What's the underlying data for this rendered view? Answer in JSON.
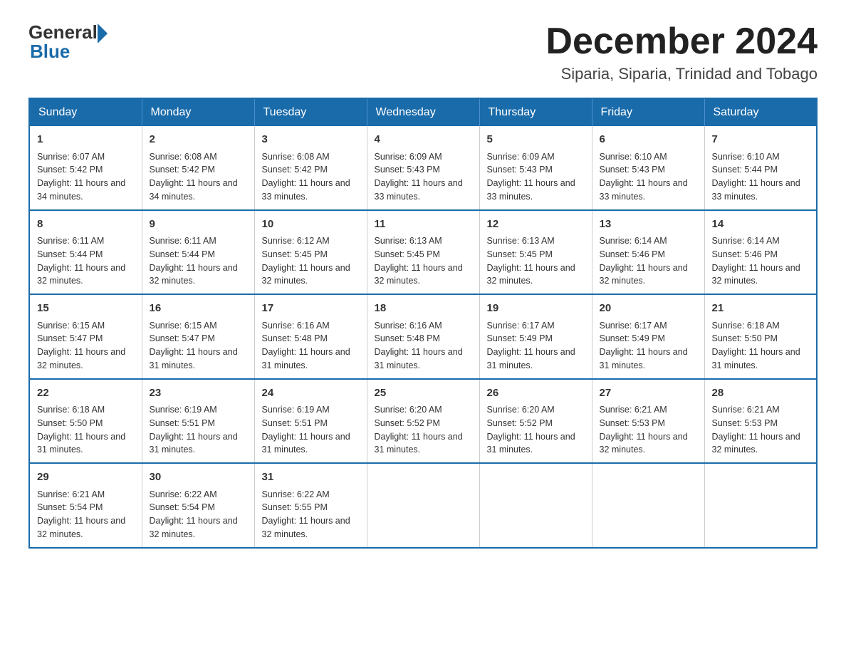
{
  "header": {
    "logo_general": "General",
    "logo_blue": "Blue",
    "title": "December 2024",
    "subtitle": "Siparia, Siparia, Trinidad and Tobago"
  },
  "calendar": {
    "headers": [
      "Sunday",
      "Monday",
      "Tuesday",
      "Wednesday",
      "Thursday",
      "Friday",
      "Saturday"
    ],
    "weeks": [
      [
        {
          "day": "1",
          "sunrise": "6:07 AM",
          "sunset": "5:42 PM",
          "daylight": "11 hours and 34 minutes."
        },
        {
          "day": "2",
          "sunrise": "6:08 AM",
          "sunset": "5:42 PM",
          "daylight": "11 hours and 34 minutes."
        },
        {
          "day": "3",
          "sunrise": "6:08 AM",
          "sunset": "5:42 PM",
          "daylight": "11 hours and 33 minutes."
        },
        {
          "day": "4",
          "sunrise": "6:09 AM",
          "sunset": "5:43 PM",
          "daylight": "11 hours and 33 minutes."
        },
        {
          "day": "5",
          "sunrise": "6:09 AM",
          "sunset": "5:43 PM",
          "daylight": "11 hours and 33 minutes."
        },
        {
          "day": "6",
          "sunrise": "6:10 AM",
          "sunset": "5:43 PM",
          "daylight": "11 hours and 33 minutes."
        },
        {
          "day": "7",
          "sunrise": "6:10 AM",
          "sunset": "5:44 PM",
          "daylight": "11 hours and 33 minutes."
        }
      ],
      [
        {
          "day": "8",
          "sunrise": "6:11 AM",
          "sunset": "5:44 PM",
          "daylight": "11 hours and 32 minutes."
        },
        {
          "day": "9",
          "sunrise": "6:11 AM",
          "sunset": "5:44 PM",
          "daylight": "11 hours and 32 minutes."
        },
        {
          "day": "10",
          "sunrise": "6:12 AM",
          "sunset": "5:45 PM",
          "daylight": "11 hours and 32 minutes."
        },
        {
          "day": "11",
          "sunrise": "6:13 AM",
          "sunset": "5:45 PM",
          "daylight": "11 hours and 32 minutes."
        },
        {
          "day": "12",
          "sunrise": "6:13 AM",
          "sunset": "5:45 PM",
          "daylight": "11 hours and 32 minutes."
        },
        {
          "day": "13",
          "sunrise": "6:14 AM",
          "sunset": "5:46 PM",
          "daylight": "11 hours and 32 minutes."
        },
        {
          "day": "14",
          "sunrise": "6:14 AM",
          "sunset": "5:46 PM",
          "daylight": "11 hours and 32 minutes."
        }
      ],
      [
        {
          "day": "15",
          "sunrise": "6:15 AM",
          "sunset": "5:47 PM",
          "daylight": "11 hours and 32 minutes."
        },
        {
          "day": "16",
          "sunrise": "6:15 AM",
          "sunset": "5:47 PM",
          "daylight": "11 hours and 31 minutes."
        },
        {
          "day": "17",
          "sunrise": "6:16 AM",
          "sunset": "5:48 PM",
          "daylight": "11 hours and 31 minutes."
        },
        {
          "day": "18",
          "sunrise": "6:16 AM",
          "sunset": "5:48 PM",
          "daylight": "11 hours and 31 minutes."
        },
        {
          "day": "19",
          "sunrise": "6:17 AM",
          "sunset": "5:49 PM",
          "daylight": "11 hours and 31 minutes."
        },
        {
          "day": "20",
          "sunrise": "6:17 AM",
          "sunset": "5:49 PM",
          "daylight": "11 hours and 31 minutes."
        },
        {
          "day": "21",
          "sunrise": "6:18 AM",
          "sunset": "5:50 PM",
          "daylight": "11 hours and 31 minutes."
        }
      ],
      [
        {
          "day": "22",
          "sunrise": "6:18 AM",
          "sunset": "5:50 PM",
          "daylight": "11 hours and 31 minutes."
        },
        {
          "day": "23",
          "sunrise": "6:19 AM",
          "sunset": "5:51 PM",
          "daylight": "11 hours and 31 minutes."
        },
        {
          "day": "24",
          "sunrise": "6:19 AM",
          "sunset": "5:51 PM",
          "daylight": "11 hours and 31 minutes."
        },
        {
          "day": "25",
          "sunrise": "6:20 AM",
          "sunset": "5:52 PM",
          "daylight": "11 hours and 31 minutes."
        },
        {
          "day": "26",
          "sunrise": "6:20 AM",
          "sunset": "5:52 PM",
          "daylight": "11 hours and 31 minutes."
        },
        {
          "day": "27",
          "sunrise": "6:21 AM",
          "sunset": "5:53 PM",
          "daylight": "11 hours and 32 minutes."
        },
        {
          "day": "28",
          "sunrise": "6:21 AM",
          "sunset": "5:53 PM",
          "daylight": "11 hours and 32 minutes."
        }
      ],
      [
        {
          "day": "29",
          "sunrise": "6:21 AM",
          "sunset": "5:54 PM",
          "daylight": "11 hours and 32 minutes."
        },
        {
          "day": "30",
          "sunrise": "6:22 AM",
          "sunset": "5:54 PM",
          "daylight": "11 hours and 32 minutes."
        },
        {
          "day": "31",
          "sunrise": "6:22 AM",
          "sunset": "5:55 PM",
          "daylight": "11 hours and 32 minutes."
        },
        {
          "day": "",
          "sunrise": "",
          "sunset": "",
          "daylight": ""
        },
        {
          "day": "",
          "sunrise": "",
          "sunset": "",
          "daylight": ""
        },
        {
          "day": "",
          "sunrise": "",
          "sunset": "",
          "daylight": ""
        },
        {
          "day": "",
          "sunrise": "",
          "sunset": "",
          "daylight": ""
        }
      ]
    ],
    "labels": {
      "sunrise": "Sunrise: ",
      "sunset": "Sunset: ",
      "daylight": "Daylight: "
    }
  }
}
